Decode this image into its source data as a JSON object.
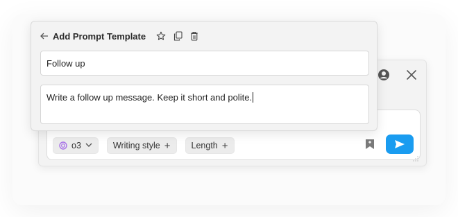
{
  "composer": {
    "model_chip": {
      "label": "o3",
      "icon": "model-orb-icon"
    },
    "chips": [
      {
        "label": "Writing style",
        "icon": "plus-icon"
      },
      {
        "label": "Length",
        "icon": "plus-icon"
      }
    ],
    "top_icons": [
      "account-icon",
      "close-icon"
    ],
    "action_icons": [
      "bookmark-icon",
      "send-icon"
    ]
  },
  "template_card": {
    "title": "Add Prompt Template",
    "header_icons": [
      "star-icon",
      "copy-icon",
      "trash-icon"
    ],
    "name_value": "Follow up",
    "body_value": "Write a follow up message. Keep it short and polite."
  },
  "colors": {
    "accent": "#1a9cf0",
    "panel_bg": "#f3f3f3",
    "model_orb": "#a872e8"
  }
}
